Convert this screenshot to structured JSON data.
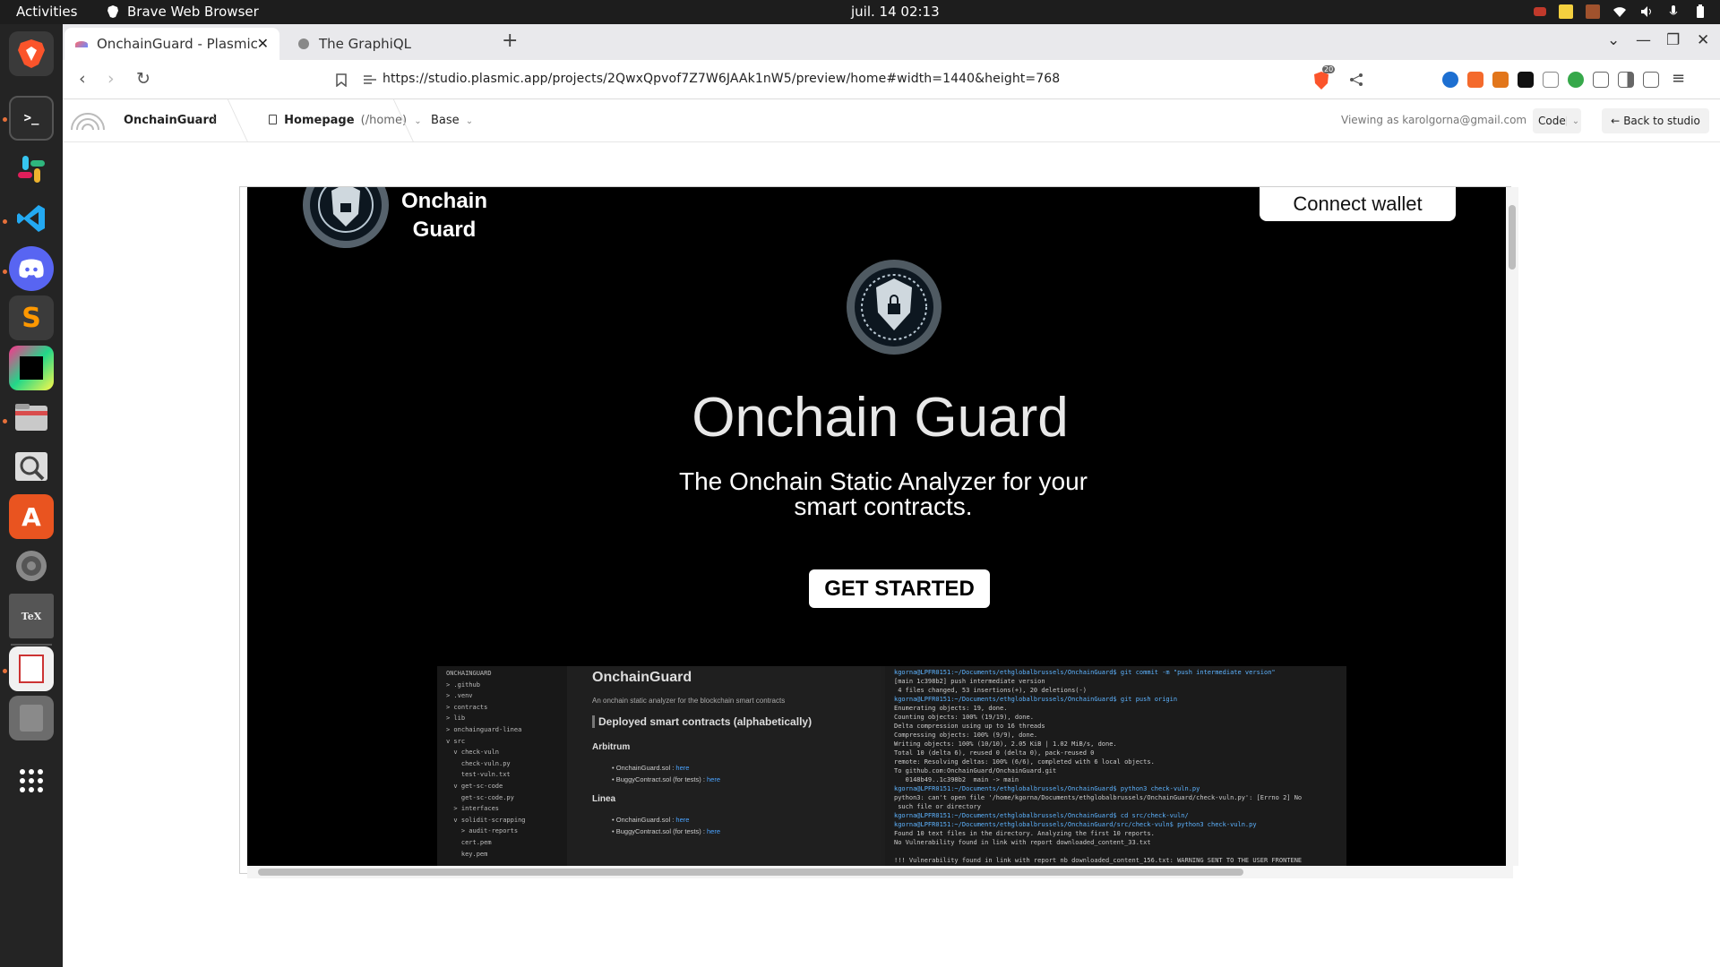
{
  "system": {
    "activities": "Activities",
    "app_name": "Brave Web Browser",
    "clock": "juil. 14  02:13"
  },
  "browser": {
    "tabs": [
      {
        "label": "OnchainGuard - Plasmic",
        "active": true
      },
      {
        "label": "The GraphiQL",
        "active": false
      }
    ],
    "new_tab": "+",
    "url": "https://studio.plasmic.app/projects/2QwxQpvof7Z7W6JAAk1nW5/preview/home#width=1440&height=768",
    "shields_count": "20"
  },
  "studio": {
    "project_name": "OnchainGuard",
    "page_label": "Homepage",
    "page_path": "(/home)",
    "variant": "Base",
    "viewing_as": "Viewing as karolgorna@gmail.com",
    "code_button": "Code",
    "back_button": "Back to studio"
  },
  "site": {
    "brand_line1": "Onchain",
    "brand_line2": "Guard",
    "connect_wallet": "Connect wallet",
    "hero_title": "Onchain Guard",
    "hero_subtitle": "The Onchain Static Analyzer for your smart contracts.",
    "cta": "GET STARTED",
    "screenshot": {
      "tree": [
        "ONCHAINGUARD",
        "> .github",
        "> .venv",
        "> contracts",
        "> lib",
        "> onchainguard-linea",
        "v src",
        "  v check-vuln",
        "    check-vuln.py",
        "    test-vuln.txt",
        "  v get-sc-code",
        "    get-sc-code.py",
        "  > interfaces",
        "  v solidit-scrapping",
        "    > audit-reports",
        "    cert.pem",
        "    key.pem"
      ],
      "doc_title": "OnchainGuard",
      "doc_desc": "An onchain static analyzer for the blockchain smart contracts",
      "doc_section": "Deployed smart contracts (alphabetically)",
      "chains": [
        {
          "name": "Arbitrum",
          "items": [
            {
              "text": "OnchainGuard.sol : ",
              "link": "here"
            },
            {
              "text": "BuggyContract.sol (for tests) : ",
              "link": "here"
            }
          ]
        },
        {
          "name": "Linea",
          "items": [
            {
              "text": "OnchainGuard.sol : ",
              "link": "here"
            },
            {
              "text": "BuggyContract.sol (for tests) : ",
              "link": "here"
            }
          ]
        }
      ],
      "terminal": [
        "kgorna@LPFR0151:~/Documents/ethglobalbrussels/OnchainGuard$ git commit -m \"push intermediate version\"",
        "[main 1c398b2] push intermediate version",
        " 4 files changed, 53 insertions(+), 20 deletions(-)",
        "kgorna@LPFR0151:~/Documents/ethglobalbrussels/OnchainGuard$ git push origin",
        "Enumerating objects: 19, done.",
        "Counting objects: 100% (19/19), done.",
        "Delta compression using up to 16 threads",
        "Compressing objects: 100% (9/9), done.",
        "Writing objects: 100% (10/10), 2.05 KiB | 1.02 MiB/s, done.",
        "Total 10 (delta 6), reused 0 (delta 0), pack-reused 0",
        "remote: Resolving deltas: 100% (6/6), completed with 6 local objects.",
        "To github.com:OnchainGuard/OnchainGuard.git",
        "   0148b49..1c398b2  main -> main",
        "kgorna@LPFR0151:~/Documents/ethglobalbrussels/OnchainGuard$ python3 check-vuln.py",
        "python3: can't open file '/home/kgorna/Documents/ethglobalbrussels/OnchainGuard/check-vuln.py': [Errno 2] No",
        " such file or directory",
        "kgorna@LPFR0151:~/Documents/ethglobalbrussels/OnchainGuard$ cd src/check-vuln/",
        "kgorna@LPFR0151:~/Documents/ethglobalbrussels/OnchainGuard/src/check-vuln$ python3 check-vuln.py",
        "Found 10 text files in the directory. Analyzing the first 10 reports.",
        "No Vulnerability found in link with report downloaded_content_33.txt",
        "",
        "!!! Vulnerability found in link with report nb downloaded_content_156.txt: WARNING SENT TO THE USER FRONTENE"
      ]
    }
  },
  "colors": {
    "accent_orange": "#e6703a",
    "site_bg": "#000000",
    "link_blue": "#4aa3ff"
  }
}
